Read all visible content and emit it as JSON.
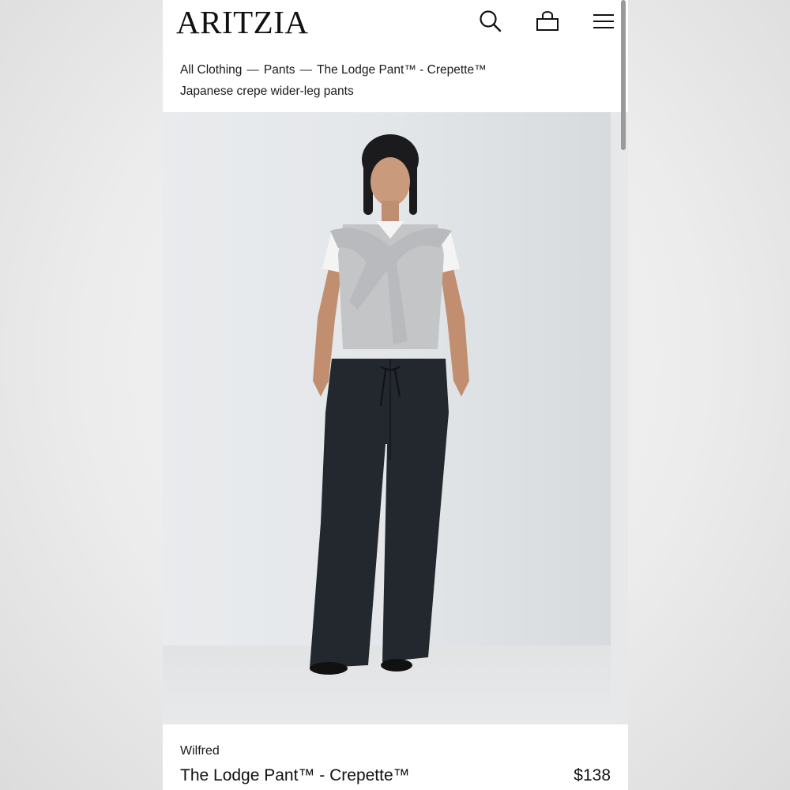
{
  "header": {
    "logo": "ARITZIA",
    "icons": [
      "search-icon",
      "bag-icon",
      "menu-icon"
    ]
  },
  "breadcrumb": {
    "items": [
      "All Clothing",
      "Pants",
      "The Lodge Pant™ - Crepette™"
    ],
    "separator": "—"
  },
  "product": {
    "subtitle": "Japanese crepe wider-leg pants",
    "brand": "Wilfred",
    "name": "The Lodge Pant™ - Crepette™",
    "price": "$138"
  },
  "colors": {
    "text": "#111111",
    "pants": "#23272e",
    "sweater": "#c4c5c7",
    "background": "#e6e8ea"
  }
}
